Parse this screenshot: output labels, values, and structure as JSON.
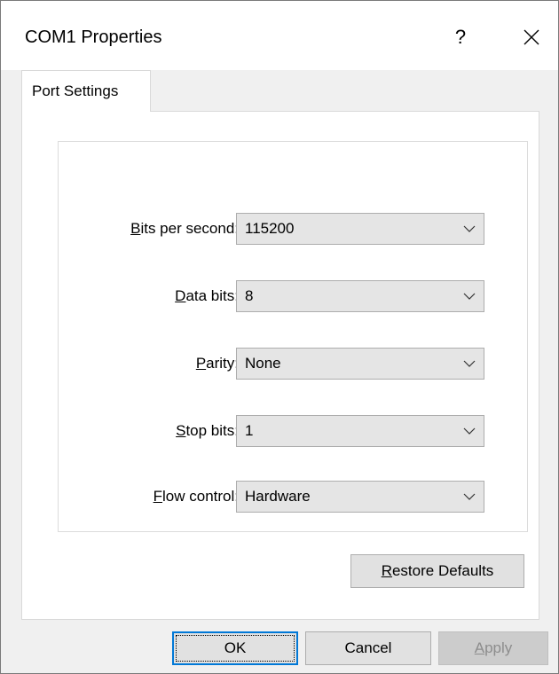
{
  "window": {
    "title": "COM1 Properties",
    "help_label": "?"
  },
  "tabs": [
    {
      "label": "Port Settings",
      "selected": true
    }
  ],
  "settings": {
    "bits_per_second": {
      "label_key": "B",
      "label_rest": "its per second:",
      "value": "115200"
    },
    "data_bits": {
      "label_key": "D",
      "label_rest": "ata bits:",
      "value": "8"
    },
    "parity": {
      "label_key": "P",
      "label_rest": "arity:",
      "value": "None"
    },
    "stop_bits": {
      "label_key": "S",
      "label_rest": "top bits:",
      "value": "1"
    },
    "flow_control": {
      "label_key": "F",
      "label_rest": "low control:",
      "value": "Hardware"
    }
  },
  "buttons": {
    "restore_key": "R",
    "restore_rest": "estore Defaults",
    "ok": "OK",
    "cancel": "Cancel",
    "apply_key": "A",
    "apply_rest": "pply"
  },
  "icons": {
    "close": "close-icon",
    "dropdown": "chevron-down-icon"
  },
  "colors": {
    "focus_border": "#0078d7",
    "disabled_text": "#8d8d8d"
  }
}
